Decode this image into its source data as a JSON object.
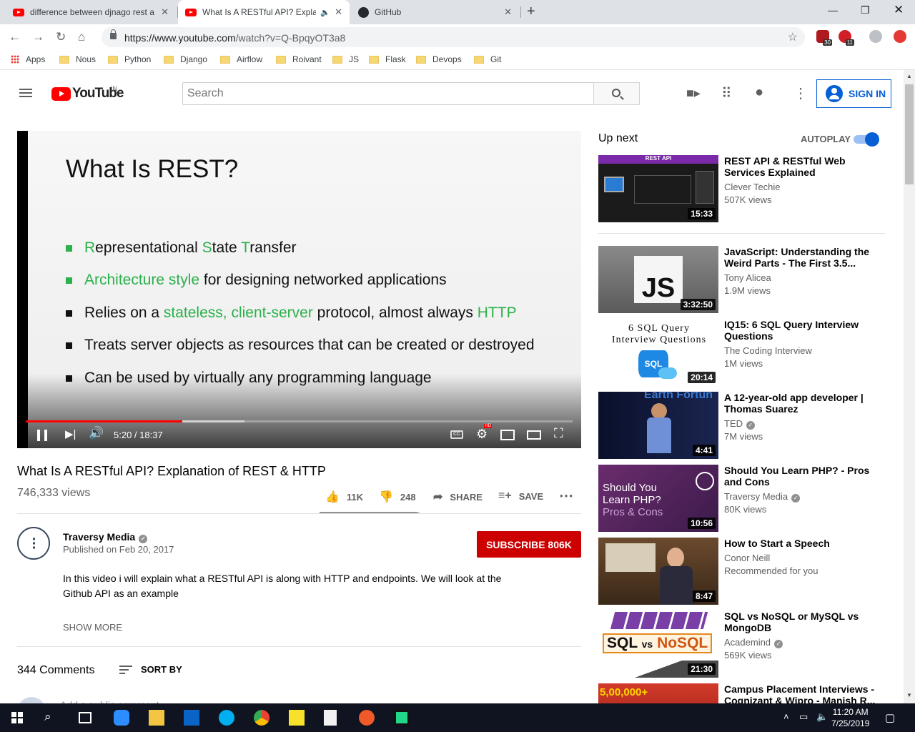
{
  "browser": {
    "tabs": [
      {
        "title": "difference between djnago rest a",
        "icon": "youtube-icon"
      },
      {
        "title": "What Is A RESTful API? Expla",
        "icon": "youtube-icon",
        "active": true
      },
      {
        "title": "GitHub",
        "icon": "github-icon"
      }
    ],
    "url_host": "https://www.youtube.com",
    "url_path": "/watch?v=Q-BpqyOT3a8",
    "ext_badges": [
      "30",
      "11"
    ],
    "bookmarks": [
      "Apps",
      "Nous",
      "Python",
      "Django",
      "Airflow",
      "Roivant",
      "JS",
      "Flask",
      "Devops",
      "Git"
    ]
  },
  "youtube": {
    "logo_text": "YouTube",
    "country": "IN",
    "search_placeholder": "Search",
    "sign_in": "SIGN IN"
  },
  "player": {
    "slide_title": "What Is REST?",
    "bullets": {
      "b1_r": "R",
      "b1_a": "epresentational ",
      "b1_s": "S",
      "b1_b": "tate ",
      "b1_t": "T",
      "b1_c": "ransfer",
      "b2_g": "Architecture style",
      "b2_rest": " for designing networked applications",
      "b3_a": "Relies on a ",
      "b3_g": "stateless, client-server",
      "b3_b": " protocol, almost always ",
      "b3_h": "HTTP",
      "b4": "Treats server objects as resources that can be created or destroyed",
      "b5": "Can be used by virtually any programming language"
    },
    "time": "5:20 / 18:37",
    "progress_fraction": 0.286,
    "buffer_fraction": 0.4,
    "hd_badge": "HD",
    "cc_label": "CC"
  },
  "video": {
    "title": "What Is A RESTful API? Explanation of REST & HTTP",
    "views": "746,333 views",
    "likes": "11K",
    "dislikes": "248",
    "share": "SHARE",
    "save": "SAVE",
    "like_ratio": 0.978
  },
  "channel": {
    "name": "Traversy Media",
    "published": "Published on Feb 20, 2017",
    "subscribe": "SUBSCRIBE  806K",
    "description": "In this video i will explain what a RESTful API is along with HTTP and endpoints. We will look at the Github API as an example",
    "show_more": "SHOW MORE"
  },
  "comments": {
    "count": "344 Comments",
    "sort_by": "SORT BY",
    "add_placeholder": "Add a public comment..."
  },
  "upnext": {
    "heading": "Up next",
    "autoplay": "AUTOPLAY",
    "items": [
      {
        "title": "REST API & RESTful Web Services Explained",
        "channel": "Clever Techie",
        "views": "507K views",
        "duration": "15:33",
        "verified": false
      },
      {
        "title": "JavaScript: Understanding the Weird Parts - The First 3.5...",
        "channel": "Tony Alicea",
        "views": "1.9M views",
        "duration": "3:32:50",
        "verified": false
      },
      {
        "title": "IQ15: 6 SQL Query Interview Questions",
        "channel": "The Coding Interview",
        "views": "1M views",
        "duration": "20:14",
        "verified": false
      },
      {
        "title": "A 12-year-old app developer | Thomas Suarez",
        "channel": "TED",
        "views": "7M views",
        "duration": "4:41",
        "verified": true
      },
      {
        "title": "Should You Learn PHP? - Pros and Cons",
        "channel": "Traversy Media",
        "views": "80K views",
        "duration": "10:56",
        "verified": true
      },
      {
        "title": "How to Start a Speech",
        "channel": "Conor Neill",
        "views": "Recommended for you",
        "duration": "8:47",
        "verified": false
      },
      {
        "title": "SQL vs NoSQL or MySQL vs MongoDB",
        "channel": "Academind",
        "views": "569K views",
        "duration": "21:30",
        "verified": true
      },
      {
        "title": "Campus Placement Interviews - Cognizant & Wipro - Manish R...",
        "channel": "",
        "views": "",
        "duration": "",
        "verified": false
      }
    ],
    "thumb_text": {
      "rest_api": "REST API",
      "js": "JS",
      "sql_title": "6 SQL Query Interview Questions",
      "sql_badge": "SQL",
      "ted_banner": "Earth Fortun",
      "php_l1": "Should You",
      "php_l2": "Learn PHP?",
      "php_l3": "Pros & Cons",
      "nosql_sql": "SQL",
      "nosql_vs": "vs",
      "nosql_no": "NoSQL",
      "campus": "5,00,000+"
    }
  },
  "taskbar": {
    "time": "11:20 AM",
    "date": "7/25/2019"
  }
}
